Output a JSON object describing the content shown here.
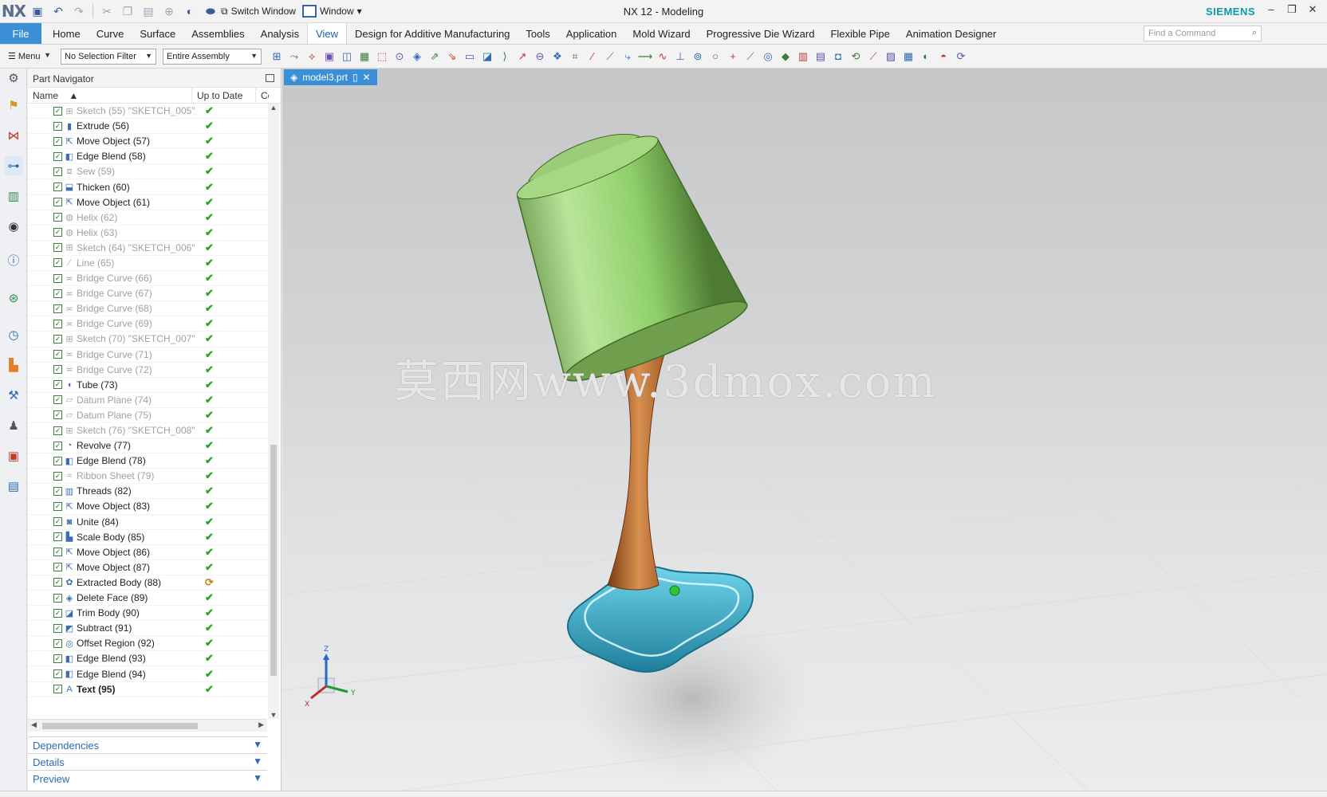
{
  "app": {
    "title": "NX 12 - Modeling",
    "brand": "SIEMENS",
    "logo": "NX"
  },
  "quick_access": {
    "switch_window": "Switch Window",
    "window": "Window"
  },
  "ribbon": {
    "file": "File",
    "tabs": [
      "Home",
      "Curve",
      "Surface",
      "Assemblies",
      "Analysis",
      "View",
      "Design for Additive Manufacturing",
      "Tools",
      "Application",
      "Mold Wizard",
      "Progressive Die Wizard",
      "Flexible Pipe",
      "Animation Designer"
    ],
    "active_tab": "View",
    "find_placeholder": "Find a Command"
  },
  "selection_bar": {
    "menu": "Menu",
    "filter": "No Selection Filter",
    "scope": "Entire Assembly"
  },
  "navigator": {
    "title": "Part Navigator",
    "columns": [
      "Name",
      "Up to Date",
      "Cc"
    ],
    "rows": [
      {
        "label": "Sketch (55) \"SKETCH_005\"",
        "icon": "sketch-icon",
        "grey": true,
        "status": "✔"
      },
      {
        "label": "Extrude (56)",
        "icon": "extrude-icon",
        "grey": false,
        "status": "✔"
      },
      {
        "label": "Move Object (57)",
        "icon": "move-object-icon",
        "grey": false,
        "status": "✔"
      },
      {
        "label": "Edge Blend (58)",
        "icon": "edge-blend-icon",
        "grey": false,
        "status": "✔"
      },
      {
        "label": "Sew (59)",
        "icon": "sew-icon",
        "grey": true,
        "status": "✔"
      },
      {
        "label": "Thicken (60)",
        "icon": "thicken-icon",
        "grey": false,
        "status": "✔"
      },
      {
        "label": "Move Object (61)",
        "icon": "move-object-icon",
        "grey": false,
        "status": "✔"
      },
      {
        "label": "Helix (62)",
        "icon": "helix-icon",
        "grey": true,
        "status": "✔"
      },
      {
        "label": "Helix (63)",
        "icon": "helix-icon",
        "grey": true,
        "status": "✔"
      },
      {
        "label": "Sketch (64) \"SKETCH_006\"",
        "icon": "sketch-icon",
        "grey": true,
        "status": "✔"
      },
      {
        "label": "Line (65)",
        "icon": "line-icon",
        "grey": true,
        "status": "✔"
      },
      {
        "label": "Bridge Curve (66)",
        "icon": "bridge-curve-icon",
        "grey": true,
        "status": "✔"
      },
      {
        "label": "Bridge Curve (67)",
        "icon": "bridge-curve-icon",
        "grey": true,
        "status": "✔"
      },
      {
        "label": "Bridge Curve (68)",
        "icon": "bridge-curve-icon",
        "grey": true,
        "status": "✔"
      },
      {
        "label": "Bridge Curve (69)",
        "icon": "bridge-curve-icon",
        "grey": true,
        "status": "✔"
      },
      {
        "label": "Sketch (70) \"SKETCH_007\"",
        "icon": "sketch-icon",
        "grey": true,
        "status": "✔"
      },
      {
        "label": "Bridge Curve (71)",
        "icon": "bridge-curve-icon",
        "grey": true,
        "status": "✔"
      },
      {
        "label": "Bridge Curve (72)",
        "icon": "bridge-curve-icon",
        "grey": true,
        "status": "✔"
      },
      {
        "label": "Tube (73)",
        "icon": "tube-icon",
        "grey": false,
        "status": "✔"
      },
      {
        "label": "Datum Plane (74)",
        "icon": "datum-plane-icon",
        "grey": true,
        "status": "✔"
      },
      {
        "label": "Datum Plane (75)",
        "icon": "datum-plane-icon",
        "grey": true,
        "status": "✔"
      },
      {
        "label": "Sketch (76) \"SKETCH_008\"",
        "icon": "sketch-icon",
        "grey": true,
        "status": "✔"
      },
      {
        "label": "Revolve (77)",
        "icon": "revolve-icon",
        "grey": false,
        "status": "✔"
      },
      {
        "label": "Edge Blend (78)",
        "icon": "edge-blend-icon",
        "grey": false,
        "status": "✔"
      },
      {
        "label": "Ribbon Sheet (79)",
        "icon": "ribbon-sheet-icon",
        "grey": true,
        "status": "✔"
      },
      {
        "label": "Threads (82)",
        "icon": "threads-icon",
        "grey": false,
        "status": "✔"
      },
      {
        "label": "Move Object (83)",
        "icon": "move-object-icon",
        "grey": false,
        "status": "✔"
      },
      {
        "label": "Unite (84)",
        "icon": "unite-icon",
        "grey": false,
        "status": "✔"
      },
      {
        "label": "Scale Body (85)",
        "icon": "scale-body-icon",
        "grey": false,
        "status": "✔"
      },
      {
        "label": "Move Object (86)",
        "icon": "move-object-icon",
        "grey": false,
        "status": "✔"
      },
      {
        "label": "Move Object (87)",
        "icon": "move-object-icon",
        "grey": false,
        "status": "✔"
      },
      {
        "label": "Extracted Body (88)",
        "icon": "extracted-body-icon",
        "grey": false,
        "status": "⟳"
      },
      {
        "label": "Delete Face (89)",
        "icon": "delete-face-icon",
        "grey": false,
        "status": "✔"
      },
      {
        "label": "Trim Body (90)",
        "icon": "trim-body-icon",
        "grey": false,
        "status": "✔"
      },
      {
        "label": "Subtract (91)",
        "icon": "subtract-icon",
        "grey": false,
        "status": "✔"
      },
      {
        "label": "Offset Region (92)",
        "icon": "offset-region-icon",
        "grey": false,
        "status": "✔"
      },
      {
        "label": "Edge Blend (93)",
        "icon": "edge-blend-icon",
        "grey": false,
        "status": "✔"
      },
      {
        "label": "Edge Blend (94)",
        "icon": "edge-blend-icon",
        "grey": false,
        "status": "✔"
      },
      {
        "label": "Text (95)",
        "icon": "text-feature-icon",
        "grey": false,
        "bold": true,
        "status": "✔"
      }
    ],
    "panels": [
      "Dependencies",
      "Details",
      "Preview"
    ]
  },
  "graphics": {
    "doc_tab": "model3.prt",
    "watermark": "莫西网www.3dmox.com",
    "triad": {
      "z": "Z",
      "y": "Y",
      "x": "X"
    }
  },
  "colors": {
    "accent": "#3b8fd6",
    "ok": "#2aa52a",
    "shade": "#8fcf6a",
    "stem": "#b4662c",
    "base": "#3aaed0"
  }
}
